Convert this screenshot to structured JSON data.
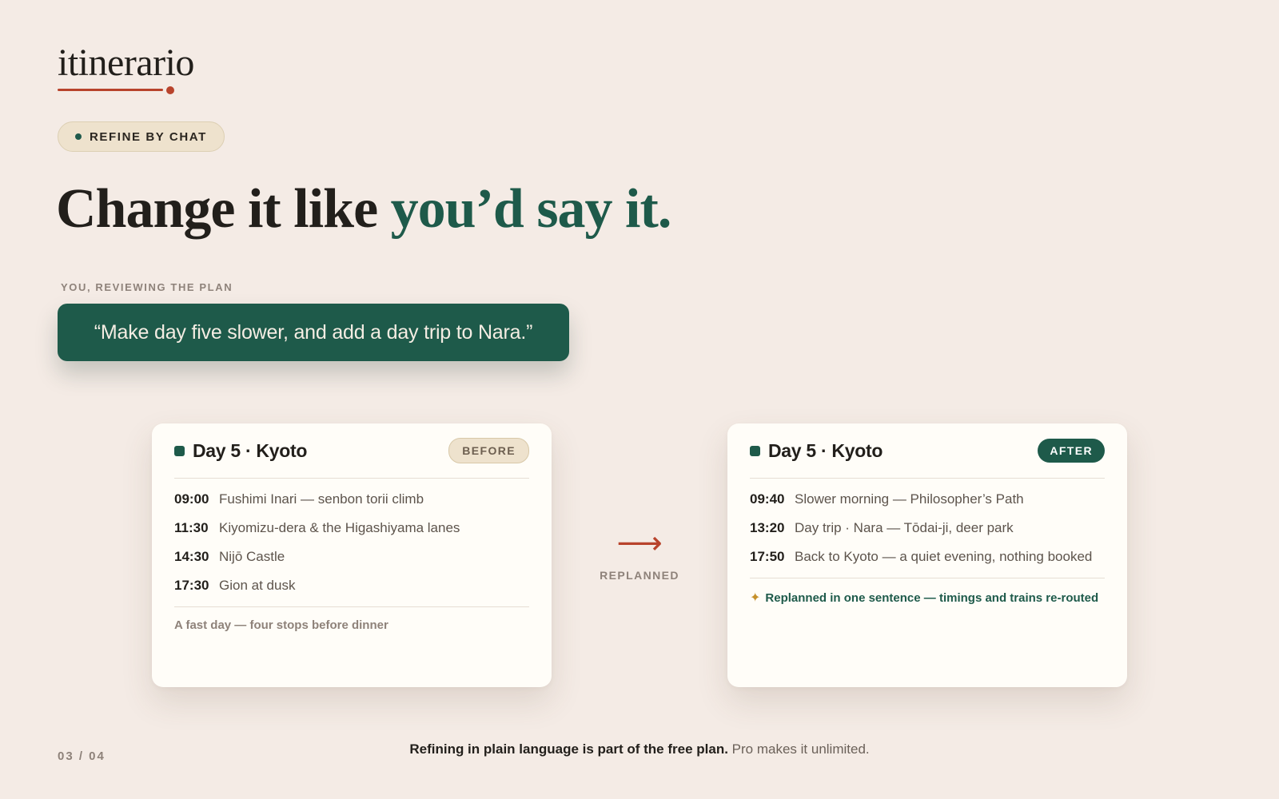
{
  "brand": {
    "name": "itinerario"
  },
  "colors": {
    "background": "#f4ebe5",
    "accent_green": "#1e5a4a",
    "accent_red": "#b8432c",
    "badge_sand": "#eee2cd",
    "sparkle_gold": "#c5902a"
  },
  "pill": {
    "label": "REFINE BY CHAT"
  },
  "headline": {
    "part1": "Change it like ",
    "part2": "you’d say it."
  },
  "chat": {
    "caption": "YOU, REVIEWING THE PLAN",
    "message": "“Make day five slower, and add a day trip to Nara.”"
  },
  "before_card": {
    "title": "Day 5 · Kyoto",
    "badge": "BEFORE",
    "items": [
      {
        "time": "09:00",
        "text": "Fushimi Inari — senbon torii climb"
      },
      {
        "time": "11:30",
        "text": "Kiyomizu-dera & the Higashiyama lanes"
      },
      {
        "time": "14:30",
        "text": "Nijō Castle"
      },
      {
        "time": "17:30",
        "text": "Gion at dusk"
      }
    ],
    "footer": "A fast day — four stops before dinner"
  },
  "transition": {
    "icon": "arrow-right-icon",
    "label": "REPLANNED"
  },
  "after_card": {
    "title": "Day 5 · Kyoto",
    "badge": "AFTER",
    "items": [
      {
        "time": "09:40",
        "text": "Slower morning — Philosopher’s Path"
      },
      {
        "time": "13:20",
        "text": "Day trip · Nara — Tōdai-ji, deer park"
      },
      {
        "time": "17:50",
        "text": "Back to Kyoto — a quiet evening, nothing booked"
      }
    ],
    "footer_icon": "sparkle-icon",
    "footer": "Replanned in one sentence — timings and trains re-routed"
  },
  "footer": {
    "page_indicator": "03 / 04",
    "note_strong": "Refining in plain language is part of the free plan.",
    "note_rest": " Pro makes it unlimited."
  }
}
